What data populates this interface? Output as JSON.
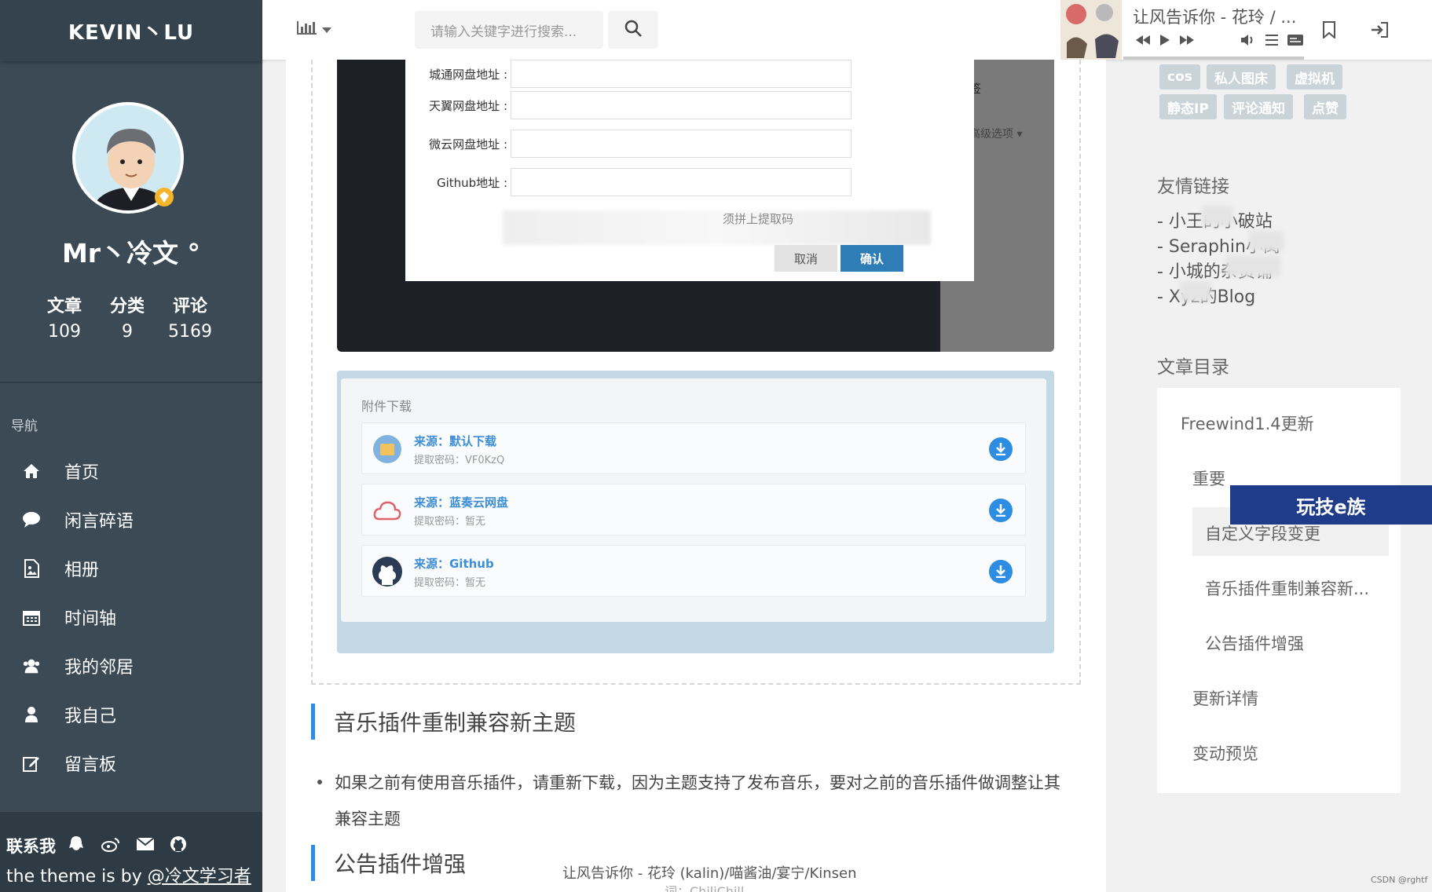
{
  "brand": "KEVIN丶LU",
  "profile": {
    "name": "Mr丶冷文 °",
    "stats": [
      {
        "label": "文章",
        "value": "109"
      },
      {
        "label": "分类",
        "value": "9"
      },
      {
        "label": "评论",
        "value": "5169"
      }
    ]
  },
  "nav": {
    "title": "导航",
    "items": [
      {
        "label": "首页",
        "icon": "home-icon"
      },
      {
        "label": "闲言碎语",
        "icon": "comment-icon"
      },
      {
        "label": "相册",
        "icon": "image-icon"
      },
      {
        "label": "时间轴",
        "icon": "calendar-icon"
      },
      {
        "label": "我的邻居",
        "icon": "users-icon"
      },
      {
        "label": "我自己",
        "icon": "user-icon"
      },
      {
        "label": "留言板",
        "icon": "edit-icon"
      }
    ]
  },
  "footer": {
    "contact_label": "联系我",
    "credit_prefix": "the theme is by ",
    "credit_link": "@冷文学习者"
  },
  "search": {
    "placeholder": "请输入关键字进行搜索..."
  },
  "player": {
    "title": "让风告诉你 - 花玲 / ..."
  },
  "dialog": {
    "fields": [
      {
        "label": "城通网盘地址 :"
      },
      {
        "label": "天翼网盘地址 :"
      },
      {
        "label": "微云网盘地址 :"
      },
      {
        "label": "Github地址 :"
      }
    ],
    "hint": "须拼上提取码",
    "cancel": "取消",
    "confirm": "确认",
    "side_label": "签",
    "side_option": "高级选项 ▾"
  },
  "attachments": {
    "title": "附件下载",
    "items": [
      {
        "source": "来源：默认下载",
        "code": "提取密码：VF0KzQ"
      },
      {
        "source": "来源：蓝奏云网盘",
        "code": "提取密码：暂无"
      },
      {
        "source": "来源：Github",
        "code": "提取密码：暂无"
      }
    ]
  },
  "article": {
    "heading1": "音乐插件重制兼容新主题",
    "bullet": "如果之前有使用音乐插件，请重新下载，因为主题支持了发布音乐，要对之前的音乐插件做调整让其兼容主题",
    "heading2": "公告插件增强",
    "lyric1": "让风告诉你 - 花玲 (kalin)/喵酱油/宴宁/Kinsen",
    "lyric2": "词：ChiliChill"
  },
  "tags": [
    "cos",
    "私人图床",
    "虚拟机",
    "静态IP",
    "评论通知",
    "点赞"
  ],
  "friends": {
    "title": "友情链接",
    "items": [
      "- 小王的小破站",
      "- Seraphin小窝",
      "- 小城的杂货铺",
      "- Xyz的Blog"
    ]
  },
  "toc": {
    "title": "文章目录",
    "items": [
      "Freewind1.4更新",
      "重要",
      "自定义字段变更",
      "音乐插件重制兼容新...",
      "公告插件增强",
      "更新详情",
      "变动预览"
    ]
  },
  "watermark": "玩技e族",
  "csdn": "CSDN @rghtf",
  "colors": {
    "sidebar": "#3b4a54",
    "accent": "#2d8de3"
  }
}
